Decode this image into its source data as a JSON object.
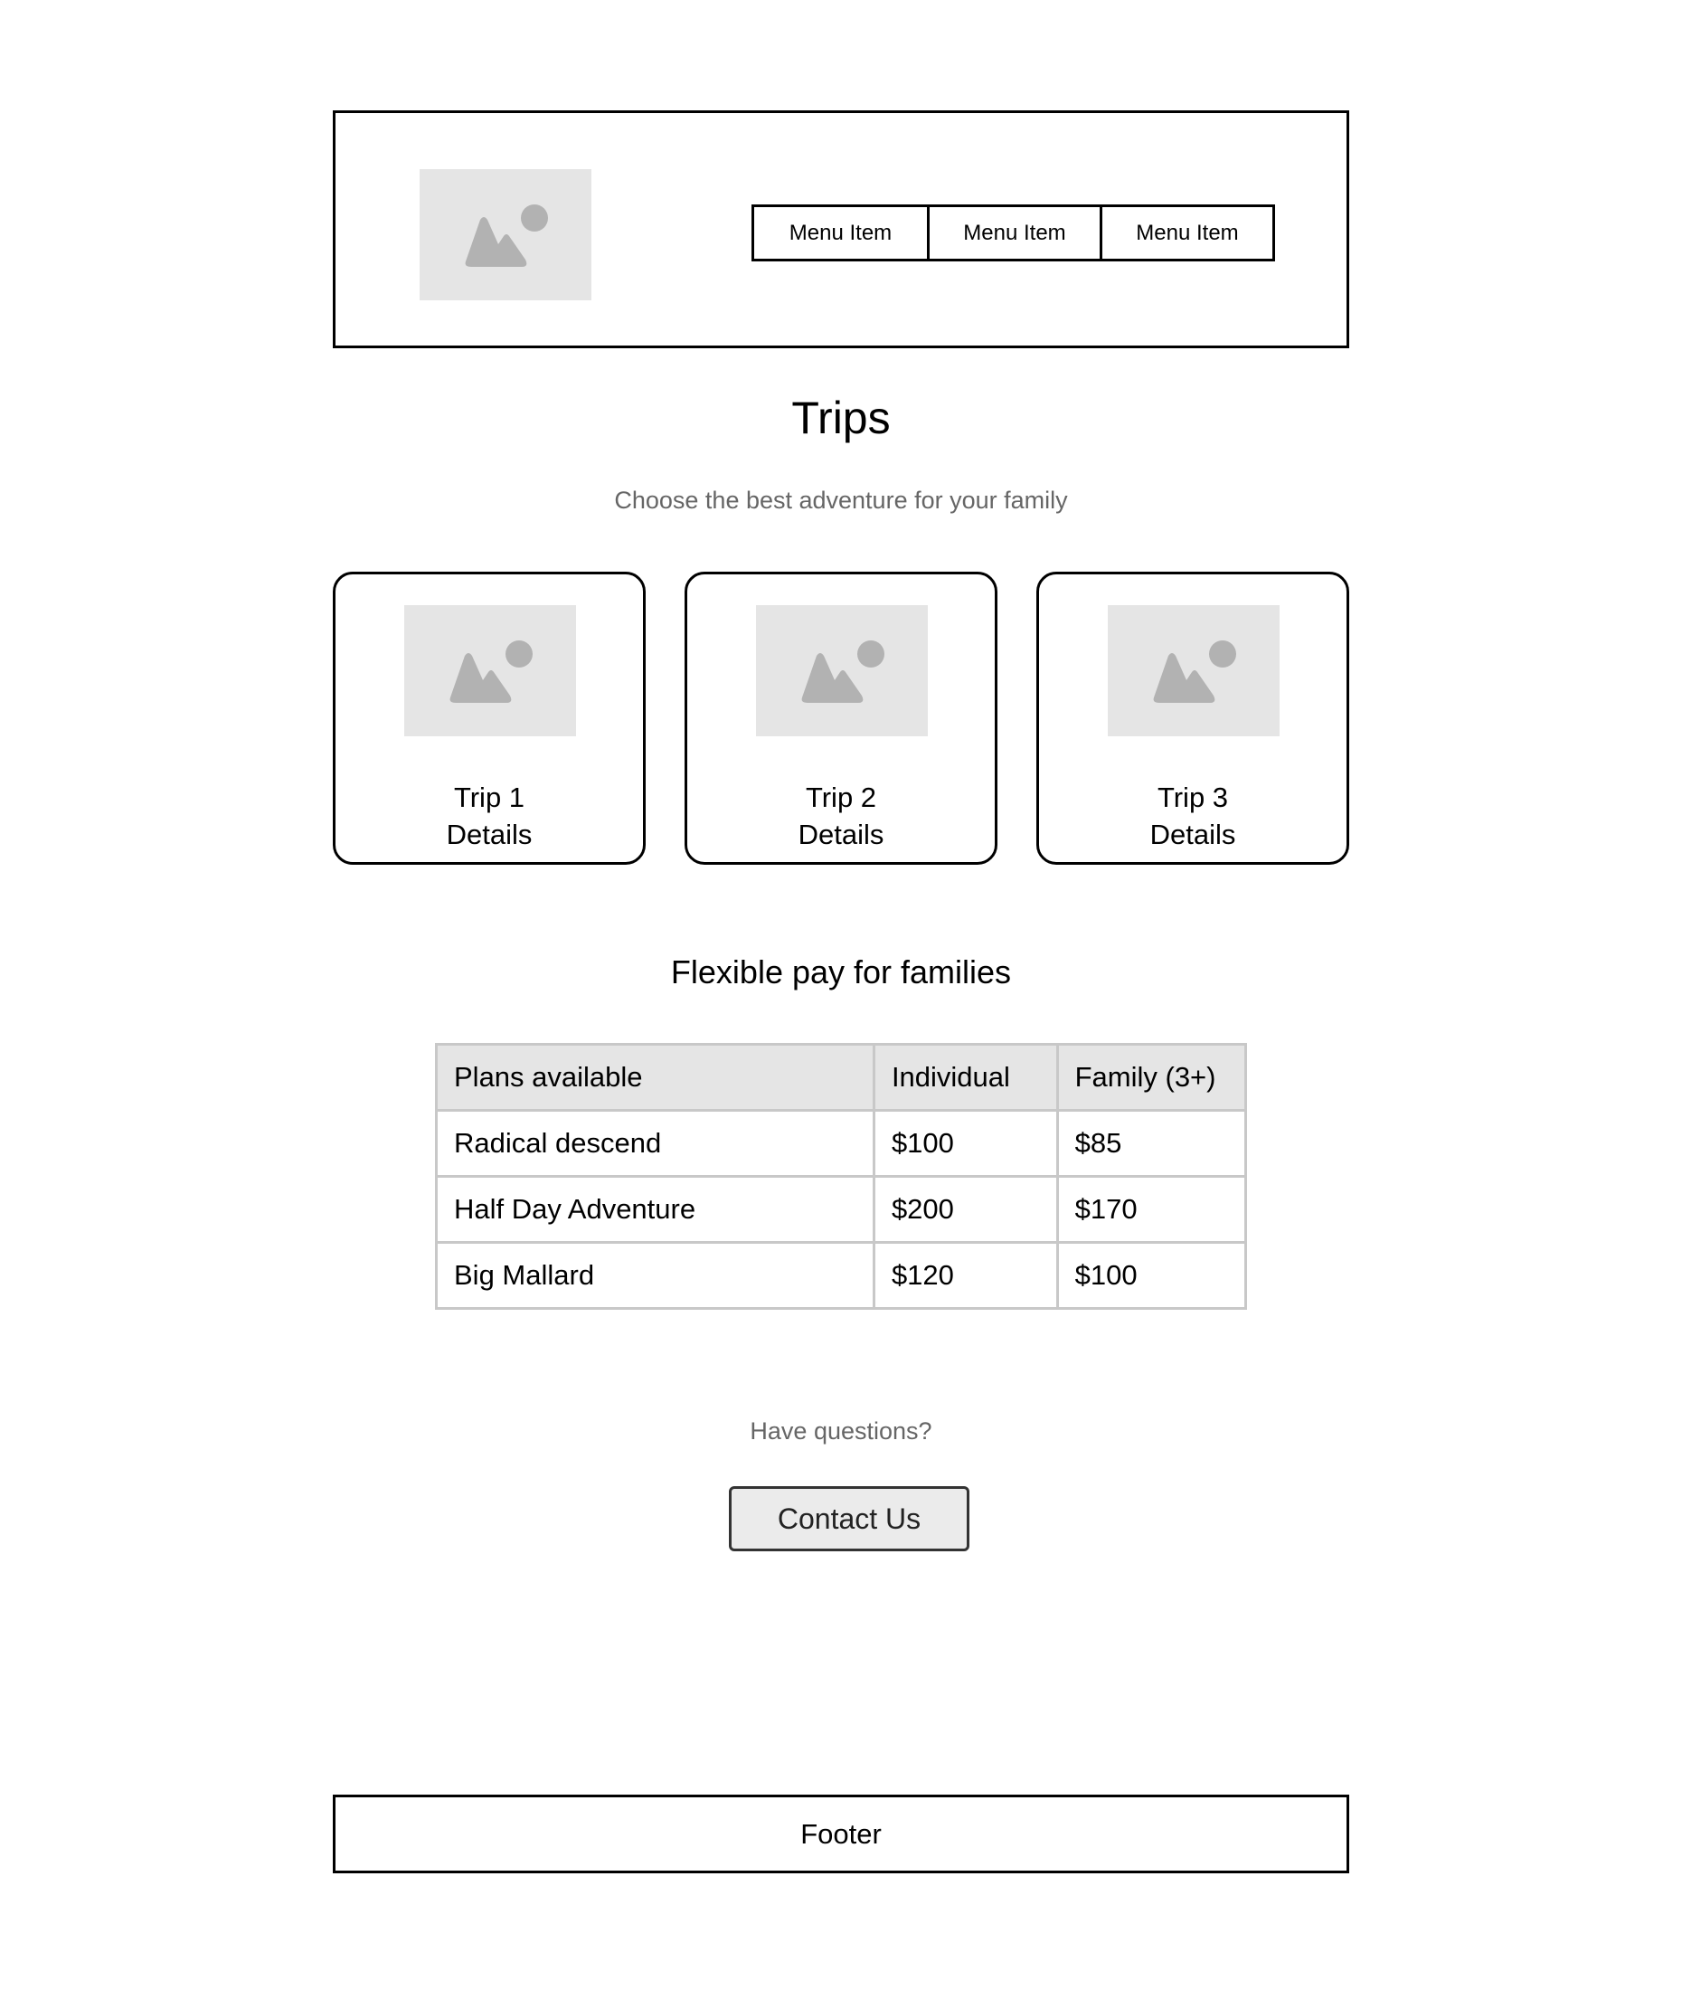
{
  "header": {
    "logo_icon": "image-placeholder-icon",
    "menu": [
      "Menu Item",
      "Menu Item",
      "Menu Item"
    ]
  },
  "hero": {
    "title": "Trips",
    "subtitle": "Choose the best adventure for your family"
  },
  "trips": [
    {
      "name": "Trip 1",
      "action": "Details",
      "icon": "image-placeholder-icon"
    },
    {
      "name": "Trip 2",
      "action": "Details",
      "icon": "image-placeholder-icon"
    },
    {
      "name": "Trip 3",
      "action": "Details",
      "icon": "image-placeholder-icon"
    }
  ],
  "pricing": {
    "title": "Flexible pay for families",
    "headers": [
      "Plans available",
      "Individual",
      "Family (3+)"
    ],
    "rows": [
      [
        "Radical descend",
        "$100",
        "$85"
      ],
      [
        "Half Day Adventure",
        "$200",
        "$170"
      ],
      [
        "Big Mallard",
        "$120",
        "$100"
      ]
    ]
  },
  "contact": {
    "question": "Have questions?",
    "button_label": "Contact Us"
  },
  "footer": {
    "label": "Footer"
  },
  "colors": {
    "placeholder_bg": "#e5e5e5",
    "placeholder_icon": "#b2b2b2",
    "table_border": "#c8c8c8",
    "muted_text": "#666666"
  }
}
